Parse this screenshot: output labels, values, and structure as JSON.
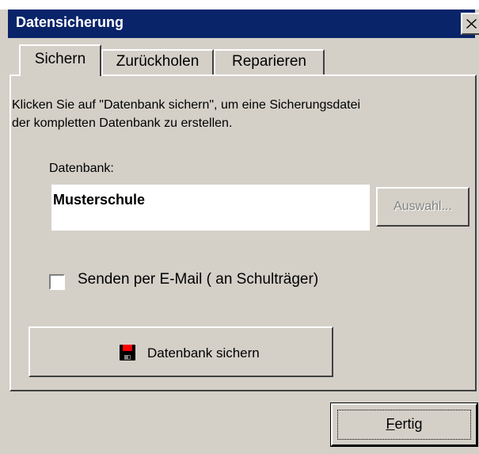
{
  "window": {
    "title": "Datensicherung",
    "close_label": "×"
  },
  "tabs": [
    {
      "label": "Sichern",
      "active": true
    },
    {
      "label": "Zurückholen",
      "active": false
    },
    {
      "label": "Reparieren",
      "active": false
    }
  ],
  "sichern": {
    "description_line1": "Klicken Sie auf \"Datenbank sichern\", um eine Sicherungsdatei",
    "description_line2": "der kompletten Datenbank zu erstellen.",
    "database_label": "Datenbank:",
    "database_value": "Musterschule",
    "auswahl_label": "Auswahl...",
    "email_checkbox_label": "Senden per E-Mail ( an Schulträger)",
    "email_checkbox_checked": false,
    "save_button_label": "Datenbank sichern",
    "save_icon": "floppy-disk-icon"
  },
  "footer": {
    "fertig_mnemonic": "F",
    "fertig_rest": "ertig"
  },
  "colors": {
    "titlebar": "#0a246a",
    "face": "#d4d0c8",
    "disabled_text": "#808080"
  }
}
